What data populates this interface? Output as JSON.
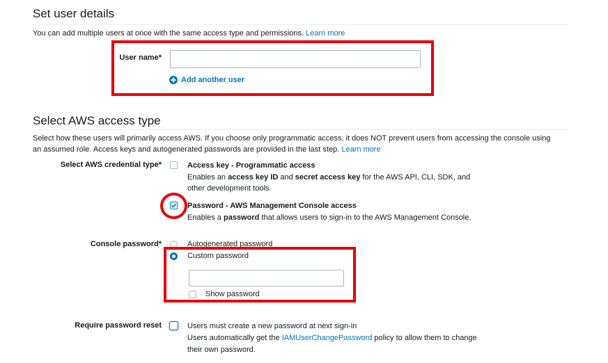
{
  "user_details": {
    "heading": "Set user details",
    "description": "You can add multiple users at once with the same access type and permissions.",
    "learn_more": "Learn more",
    "user_name_label": "User name*",
    "user_name_value": "",
    "add_another_user": "Add another user"
  },
  "access_type": {
    "heading": "Select AWS access type",
    "description_line1": "Select how these users will primarily access AWS. If you choose only programmatic access, it does NOT prevent users from accessing the console using",
    "description_line2": "an assumed role. Access keys and autogenerated passwords are provided in the last step.",
    "learn_more": "Learn more",
    "credential_type_label": "Select AWS credential type*",
    "access_key": {
      "title": "Access key - Programmatic access",
      "desc_part1": "Enables an ",
      "desc_bold1": "access key ID",
      "desc_part2": " and ",
      "desc_bold2": "secret access key",
      "desc_part3": " for the AWS API, CLI, SDK, and",
      "desc_line2": "other development tools.",
      "checked": false
    },
    "password_access": {
      "title": "Password - AWS Management Console access",
      "desc_part1": "Enables a ",
      "desc_bold": "password",
      "desc_part2": " that allows users to sign-in to the AWS Management Console.",
      "checked": true
    }
  },
  "console_password": {
    "label": "Console password*",
    "option_autogenerated": "Autogenerated password",
    "option_custom": "Custom password",
    "selected": "Custom password",
    "password_value": "",
    "show_password": "Show password"
  },
  "password_reset": {
    "label": "Require password reset",
    "text": "Users must create a new password at next sign-in",
    "note_part1": "Users automatically get the ",
    "note_link": "IAMUserChangePassword",
    "note_part2": " policy to allow them to change",
    "note_line2": "their own password."
  },
  "colors": {
    "link": "#0073bb",
    "annotation_red": "#e8000b",
    "text": "#16191f"
  },
  "icons": {
    "add_user": "plus-circle-icon",
    "checkmark": "checkmark-icon"
  }
}
